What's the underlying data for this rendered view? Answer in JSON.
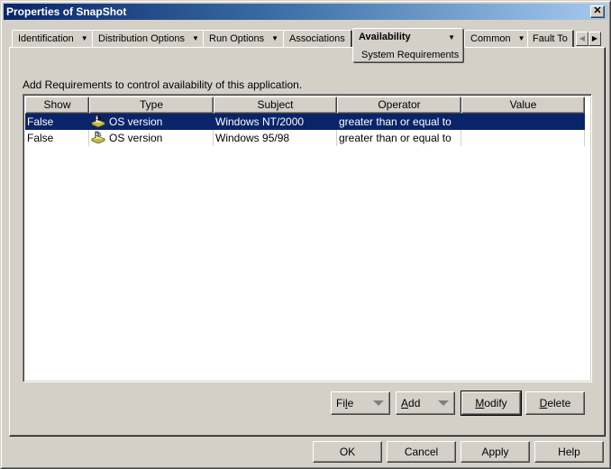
{
  "window": {
    "title": "Properties of SnapShot",
    "close_glyph": "✕"
  },
  "tabs": [
    {
      "label": "Identification",
      "has_dropdown": true
    },
    {
      "label": "Distribution Options",
      "has_dropdown": true
    },
    {
      "label": "Run Options",
      "has_dropdown": true
    },
    {
      "label": "Associations",
      "has_dropdown": false
    },
    {
      "label": "Availability",
      "has_dropdown": true,
      "active": true,
      "subpage": "System Requirements"
    },
    {
      "label": "Common",
      "has_dropdown": true
    },
    {
      "label": "Fault To",
      "has_dropdown": false
    }
  ],
  "tab_scroll": {
    "left_glyph": "◀",
    "right_glyph": "▶"
  },
  "arrow_glyph": "▼",
  "panel": {
    "instructions": "Add Requirements to control availability of this application.",
    "table": {
      "columns": [
        "Show",
        "Type",
        "Subject",
        "Operator",
        "Value"
      ],
      "rows": [
        {
          "show": "False",
          "type_icon": "os-version-icon",
          "type": "OS version",
          "subject": "Windows NT/2000",
          "operator": "greater than or equal to",
          "value": "",
          "selected": true
        },
        {
          "show": "False",
          "type_icon": "os-version-icon",
          "type": "OS version",
          "subject": "Windows 95/98",
          "operator": "greater than or equal to",
          "value": "",
          "selected": false
        }
      ]
    },
    "buttons": {
      "file": {
        "pre": "Fi",
        "accel": "l",
        "post": "e"
      },
      "add": {
        "pre": "",
        "accel": "A",
        "post": "dd"
      },
      "modify": {
        "pre": "",
        "accel": "M",
        "post": "odify"
      },
      "delete": {
        "pre": "",
        "accel": "D",
        "post": "elete"
      }
    }
  },
  "footer": {
    "ok": "OK",
    "cancel": "Cancel",
    "apply": "Apply",
    "help": "Help"
  },
  "colors": {
    "selection": "#0a246a",
    "face": "#d4d0c8"
  }
}
